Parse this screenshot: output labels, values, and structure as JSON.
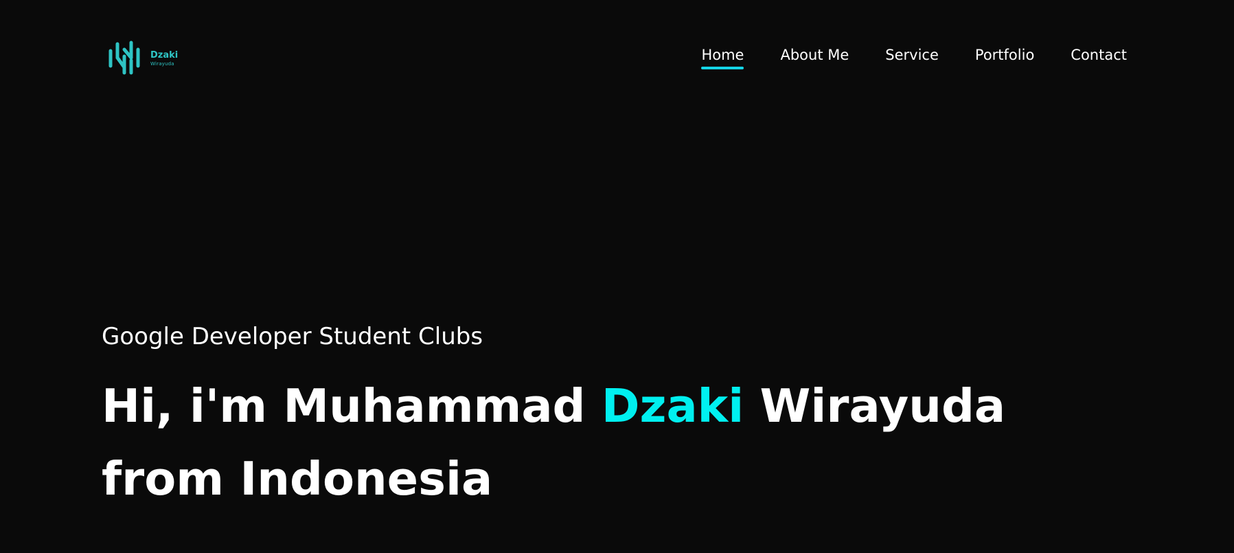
{
  "brand": {
    "name": "Dzaki",
    "subtitle": "Wirayuda",
    "accent_color": "#00f0f0",
    "logo_icon": "waveform-logo-icon"
  },
  "nav": {
    "active_index": 0,
    "items": [
      {
        "label": "Home"
      },
      {
        "label": "About Me"
      },
      {
        "label": "Service"
      },
      {
        "label": "Portfolio"
      },
      {
        "label": "Contact"
      }
    ]
  },
  "hero": {
    "subtitle": "Google Developer Student Clubs",
    "title_prefix": "Hi, i'm Muhammad ",
    "title_highlight": "Dzaki",
    "title_suffix": " Wirayuda",
    "title_line2": "from Indonesia"
  },
  "colors": {
    "background": "#0a0a0a",
    "text": "#ffffff",
    "nav_underline": "#14d4e6"
  }
}
